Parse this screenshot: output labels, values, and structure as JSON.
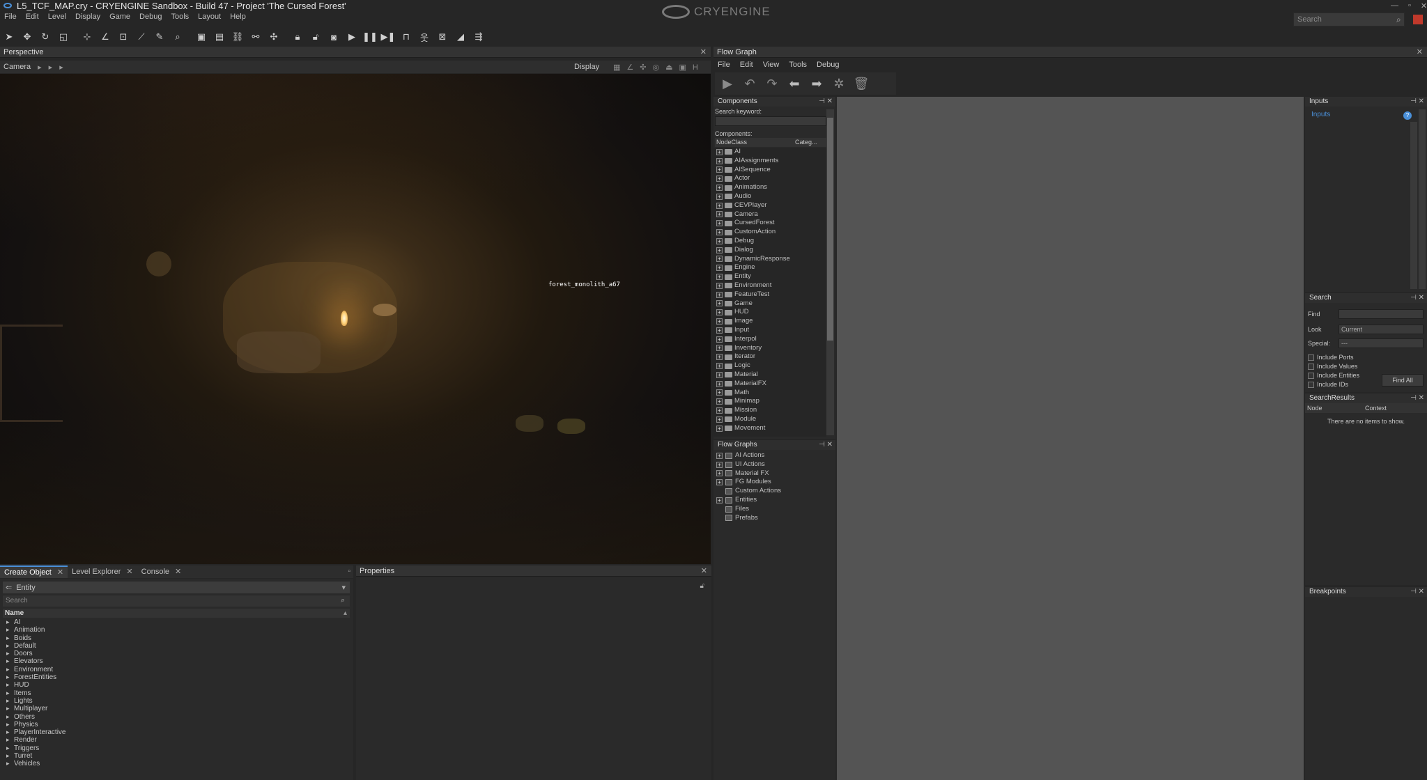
{
  "window": {
    "title": "L5_TCF_MAP.cry - CRYENGINE Sandbox - Build 47 - Project 'The Cursed Forest'",
    "logo_text": "CRYENGINE",
    "search_placeholder": "Search"
  },
  "menu": [
    "File",
    "Edit",
    "Level",
    "Display",
    "Game",
    "Debug",
    "Tools",
    "Layout",
    "Help"
  ],
  "viewport": {
    "title": "Perspective",
    "camera_label": "Camera",
    "display_label": "Display",
    "object_label": "forest_monolith_a67"
  },
  "bottom_tabs": [
    {
      "label": "Create Object"
    },
    {
      "label": "Level Explorer"
    },
    {
      "label": "Console"
    }
  ],
  "create_object": {
    "category": "Entity",
    "search_placeholder": "Search",
    "column": "Name",
    "items": [
      "AI",
      "Animation",
      "Boids",
      "Default",
      "Doors",
      "Elevators",
      "Environment",
      "ForestEntities",
      "HUD",
      "Items",
      "Lights",
      "Multiplayer",
      "Others",
      "Physics",
      "PlayerInteractive",
      "Render",
      "Triggers",
      "Turret",
      "Vehicles"
    ]
  },
  "properties": {
    "title": "Properties"
  },
  "flow_graph": {
    "title": "Flow Graph",
    "menu": [
      "File",
      "Edit",
      "View",
      "Tools",
      "Debug"
    ]
  },
  "components": {
    "title": "Components",
    "search_label": "Search keyword:",
    "list_label": "Components:",
    "col_nodeclass": "NodeClass",
    "col_category": "Categ...",
    "items": [
      "AI",
      "AIAssignments",
      "AISequence",
      "Actor",
      "Animations",
      "Audio",
      "CEVPlayer",
      "Camera",
      "CursedForest",
      "CustomAction",
      "Debug",
      "Dialog",
      "DynamicResponse",
      "Engine",
      "Entity",
      "Environment",
      "FeatureTest",
      "Game",
      "HUD",
      "Image",
      "Input",
      "Interpol",
      "Inventory",
      "Iterator",
      "Logic",
      "Material",
      "MaterialFX",
      "Math",
      "Minimap",
      "Mission",
      "Module",
      "Movement"
    ]
  },
  "flow_graphs": {
    "title": "Flow Graphs",
    "items": [
      "AI Actions",
      "UI Actions",
      "Material FX",
      "FG Modules",
      "Custom Actions",
      "Entities",
      "Files",
      "Prefabs"
    ]
  },
  "inputs": {
    "title": "Inputs",
    "item": "Inputs"
  },
  "search": {
    "title": "Search",
    "find_label": "Find",
    "look_label": "Look",
    "look_value": "Current",
    "special_label": "Special:",
    "special_value": "---",
    "options": [
      "Include Ports",
      "Include Values",
      "Include Entities",
      "Include IDs"
    ],
    "find_all": "Find All"
  },
  "search_results": {
    "title": "SearchResults",
    "col_node": "Node",
    "col_context": "Context",
    "empty": "There are no items to show."
  },
  "breakpoints": {
    "title": "Breakpoints"
  }
}
